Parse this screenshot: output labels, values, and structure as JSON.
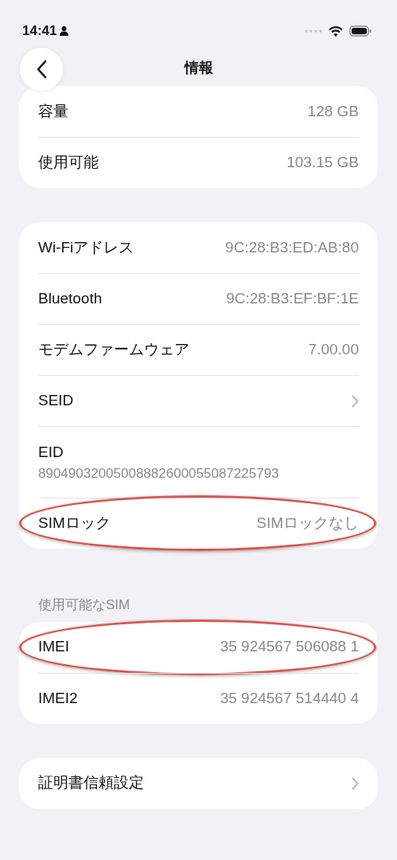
{
  "status_bar": {
    "time": "14:41"
  },
  "header": {
    "title": "情報"
  },
  "groups": [
    {
      "rows": [
        {
          "kind": "value",
          "label": "容量",
          "value": "128 GB",
          "highlighted": false
        },
        {
          "kind": "value",
          "label": "使用可能",
          "value": "103.15 GB",
          "highlighted": false
        }
      ]
    },
    {
      "rows": [
        {
          "kind": "value",
          "label": "Wi-Fiアドレス",
          "value": "9C:28:B3:ED:AB:80",
          "highlighted": false
        },
        {
          "kind": "value",
          "label": "Bluetooth",
          "value": "9C:28:B3:EF:BF:1E",
          "highlighted": false
        },
        {
          "kind": "value",
          "label": "モデムファームウェア",
          "value": "7.00.00",
          "highlighted": false
        },
        {
          "kind": "chevron",
          "label": "SEID",
          "highlighted": false
        },
        {
          "kind": "stacked",
          "label": "EID",
          "value": "89049032005008882600055087225793",
          "highlighted": false
        },
        {
          "kind": "value",
          "label": "SIMロック",
          "value": "SIMロックなし",
          "highlighted": true
        }
      ]
    },
    {
      "section_title": "使用可能なSIM",
      "rows": [
        {
          "kind": "value",
          "label": "IMEI",
          "value": "35 924567 506088 1",
          "highlighted": true
        },
        {
          "kind": "value",
          "label": "IMEI2",
          "value": "35 924567 514440 4",
          "highlighted": false
        }
      ]
    },
    {
      "rows": [
        {
          "kind": "chevron",
          "label": "証明書信頼設定",
          "highlighted": false
        }
      ]
    }
  ]
}
